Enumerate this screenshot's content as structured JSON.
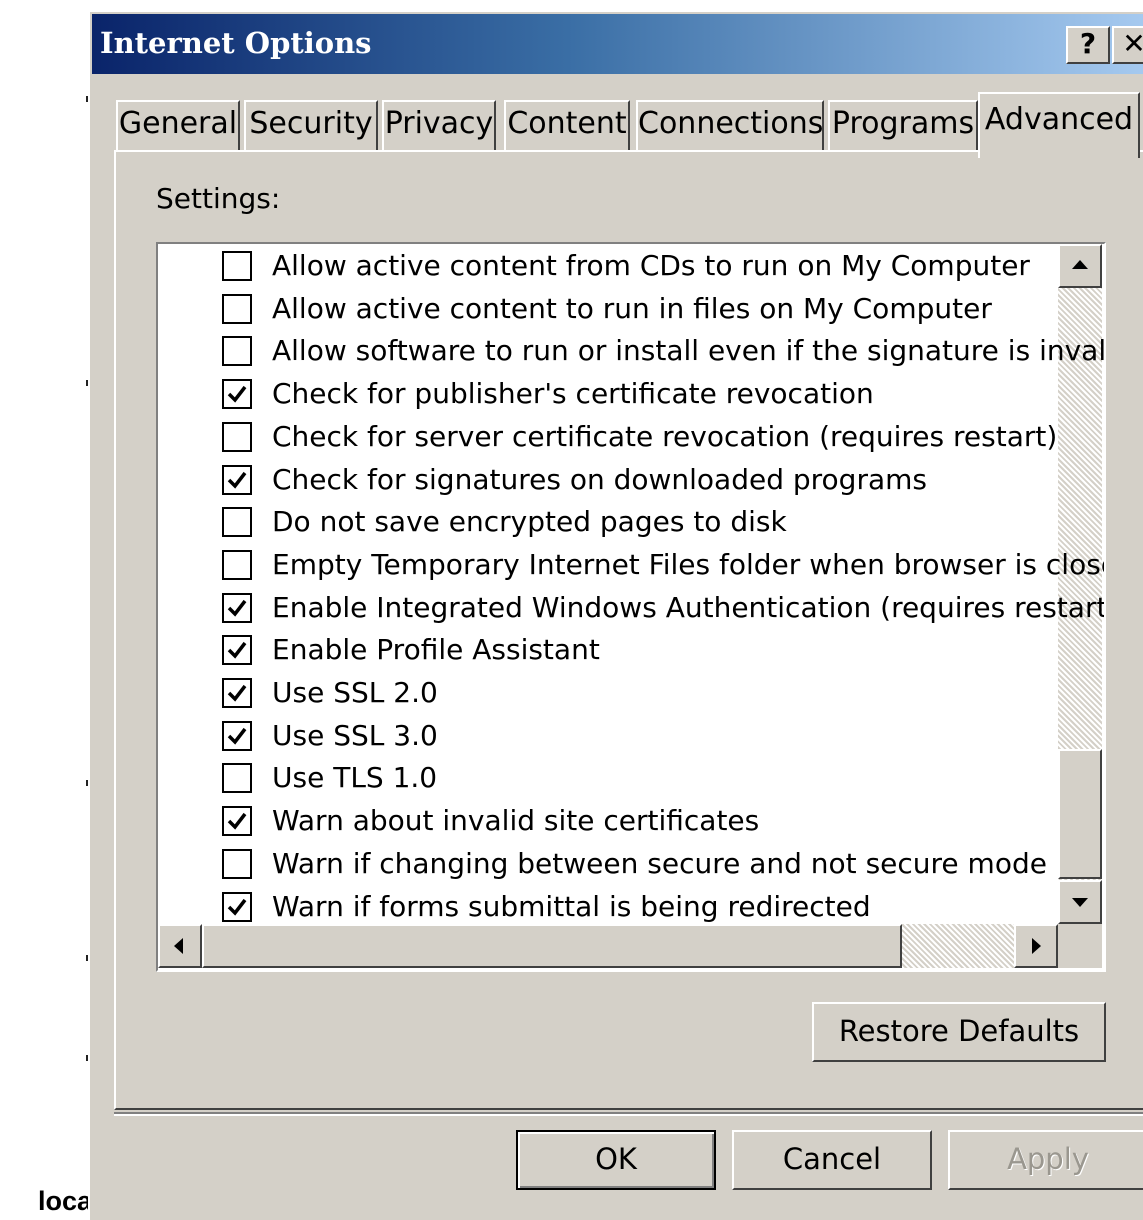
{
  "background": {
    "label": "local"
  },
  "window": {
    "title": "Internet Options",
    "help_glyph": "?",
    "close_glyph": "✕",
    "titlebar_color": "#0a246a"
  },
  "tabs": [
    {
      "label": "General",
      "active": false
    },
    {
      "label": "Security",
      "active": false
    },
    {
      "label": "Privacy",
      "active": false
    },
    {
      "label": "Content",
      "active": false
    },
    {
      "label": "Connections",
      "active": false
    },
    {
      "label": "Programs",
      "active": false
    },
    {
      "label": "Advanced",
      "active": true
    }
  ],
  "settings": {
    "label": "Settings:",
    "items": [
      {
        "label": "Allow active content from CDs to run on My Computer",
        "checked": false
      },
      {
        "label": "Allow active content to run in files on My Computer",
        "checked": false
      },
      {
        "label": "Allow software to run or install even if the signature is invalid",
        "checked": false
      },
      {
        "label": "Check for publisher's certificate revocation",
        "checked": true
      },
      {
        "label": "Check for server certificate revocation (requires restart)",
        "checked": false
      },
      {
        "label": "Check for signatures on downloaded programs",
        "checked": true
      },
      {
        "label": "Do not save encrypted pages to disk",
        "checked": false
      },
      {
        "label": "Empty Temporary Internet Files folder when browser is closed",
        "checked": false
      },
      {
        "label": "Enable Integrated Windows Authentication (requires restart)",
        "checked": true
      },
      {
        "label": "Enable Profile Assistant",
        "checked": true
      },
      {
        "label": "Use SSL 2.0",
        "checked": true
      },
      {
        "label": "Use SSL 3.0",
        "checked": true
      },
      {
        "label": "Use TLS 1.0",
        "checked": false
      },
      {
        "label": "Warn about invalid site certificates",
        "checked": true
      },
      {
        "label": "Warn if changing between secure and not secure mode",
        "checked": false
      },
      {
        "label": "Warn if forms submittal is being redirected",
        "checked": true
      }
    ]
  },
  "buttons": {
    "restore_defaults": "Restore Defaults",
    "ok": "OK",
    "cancel": "Cancel",
    "apply": "Apply"
  }
}
